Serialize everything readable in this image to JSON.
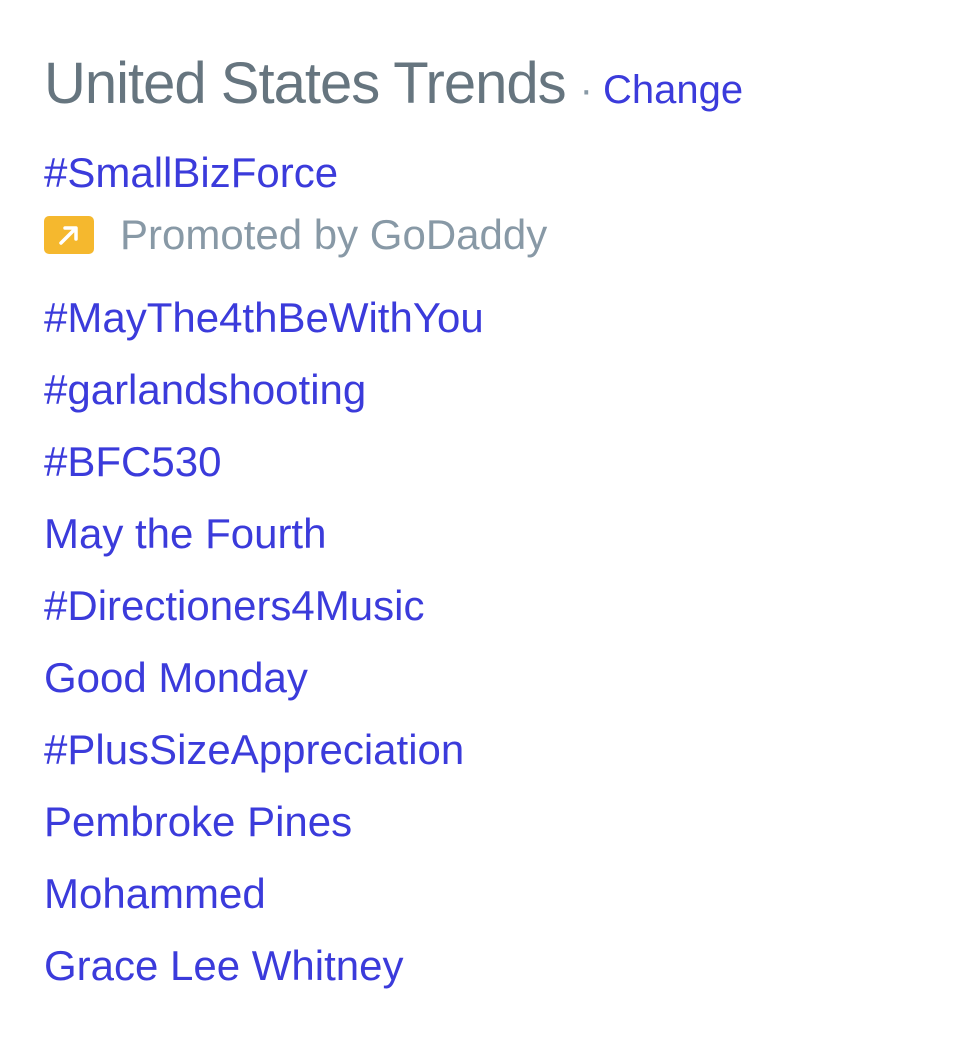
{
  "header": {
    "title": "United States Trends",
    "separator": "·",
    "change_label": "Change"
  },
  "promoted": {
    "trend": "#SmallBizForce",
    "label": "Promoted by GoDaddy",
    "icon": "promoted-arrow-icon",
    "icon_color": "#f5b82e"
  },
  "trends": [
    "#MayThe4thBeWithYou",
    "#garlandshooting",
    "#BFC530",
    "May the Fourth",
    "#Directioners4Music",
    "Good Monday",
    "#PlusSizeAppreciation",
    "Pembroke Pines",
    "Mohammed",
    "Grace Lee Whitney"
  ],
  "colors": {
    "link": "#3b3bdb",
    "title": "#66757f",
    "muted": "#8899a6"
  }
}
